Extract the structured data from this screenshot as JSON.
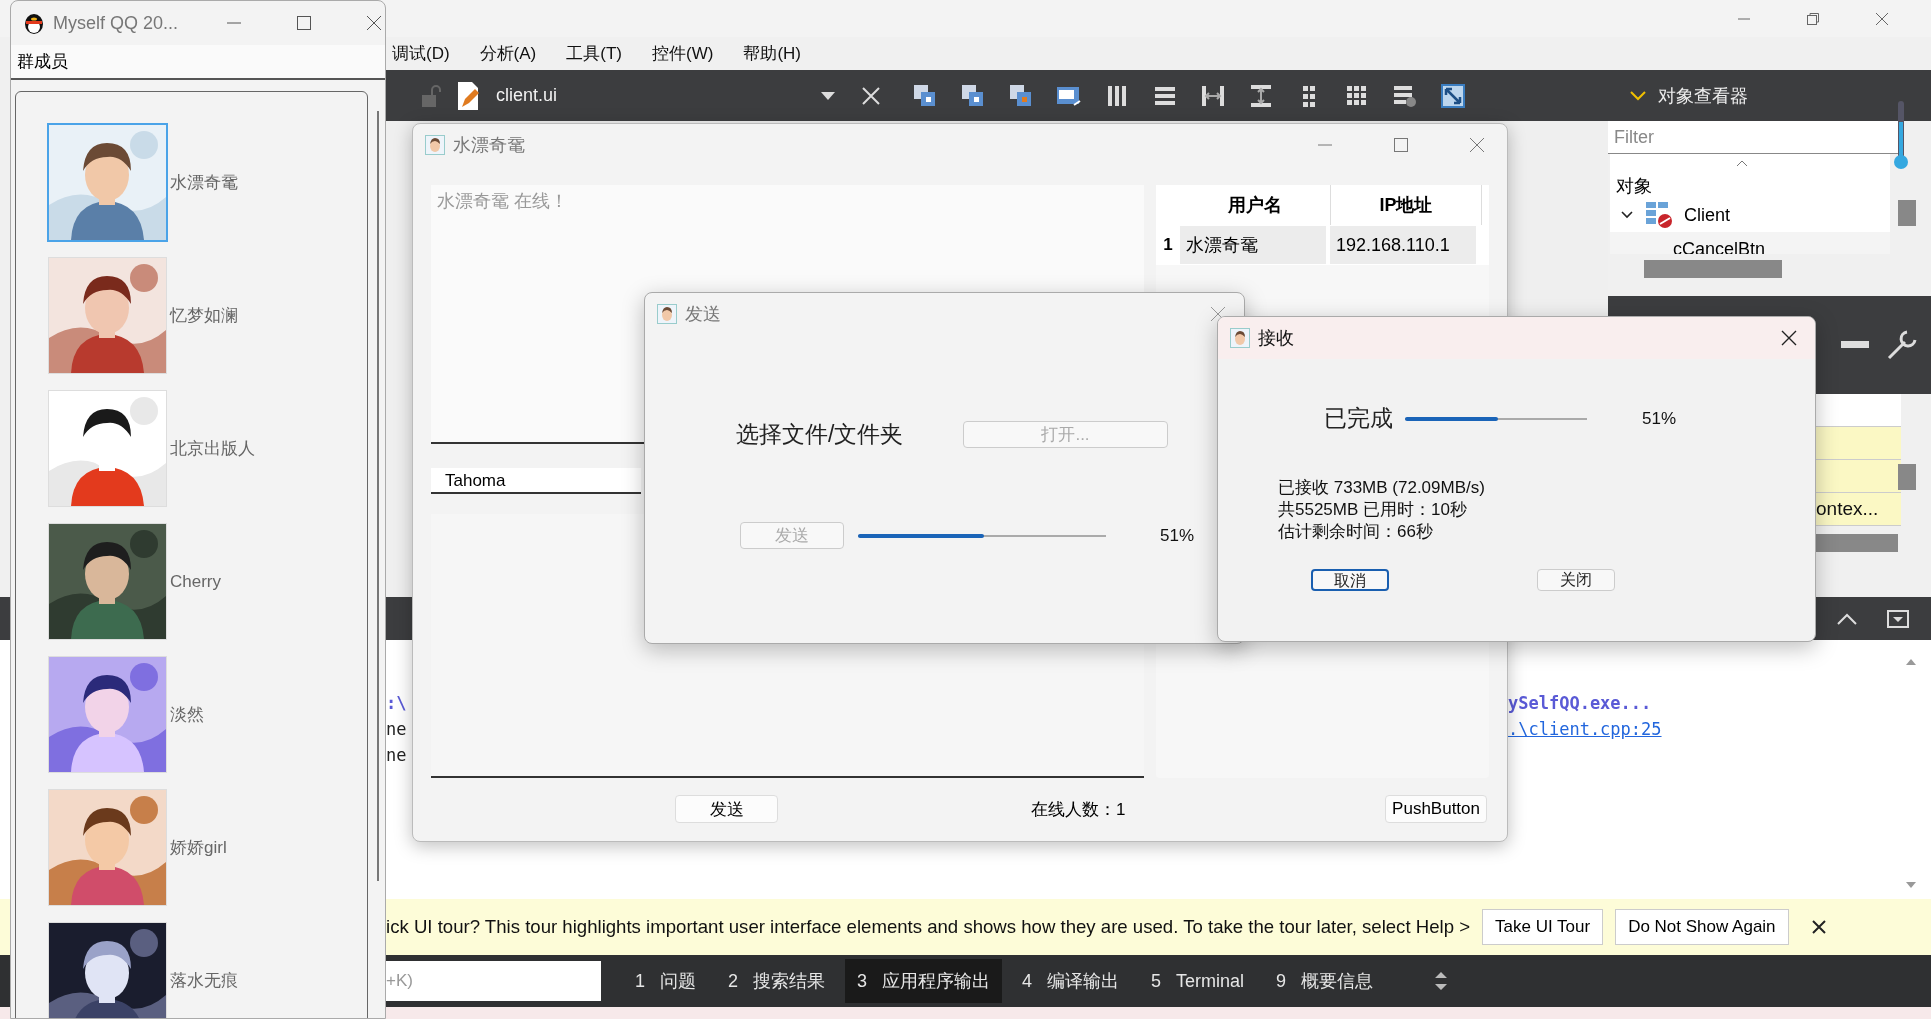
{
  "ide": {
    "menu": [
      "调试(D)",
      "分析(A)",
      "工具(T)",
      "控件(W)",
      "帮助(H)"
    ],
    "toolbar": {
      "file": "client.ui"
    },
    "object_inspector": {
      "title": "对象查看器",
      "filter_placeholder": "Filter",
      "column": "对象",
      "tree": [
        {
          "name": "Client",
          "expanded": true,
          "children": [
            {
              "name": "cCancelBtn"
            }
          ]
        }
      ]
    },
    "property_text": "ontex...",
    "output": {
      "left_lines": [
        {
          "text": ":\\",
          "kind": "path"
        },
        {
          "text": "ne",
          "kind": "plain"
        },
        {
          "text": "ne",
          "kind": "plain"
        }
      ],
      "right_lines": [
        {
          "text": "ySelfQQ.exe...",
          "kind": "path"
        },
        {
          "text": ".\\client.cpp:25",
          "kind": "link"
        }
      ]
    },
    "tour_bar": {
      "message": "ick UI tour? This tour highlights important user interface elements and shows how they are used. To take the tour later, select Help >",
      "buttons": [
        "Take UI Tour",
        "Do Not Show Again"
      ]
    },
    "locator": {
      "value": "+K)"
    },
    "output_tabs": [
      {
        "number": "1",
        "label": "问题",
        "selected": false
      },
      {
        "number": "2",
        "label": "搜索结果",
        "selected": false
      },
      {
        "number": "3",
        "label": "应用程序输出",
        "selected": true
      },
      {
        "number": "4",
        "label": "编译输出",
        "selected": false
      },
      {
        "number": "5",
        "label": "Terminal",
        "selected": false
      },
      {
        "number": "9",
        "label": "概要信息",
        "selected": false
      }
    ]
  },
  "qq_window": {
    "title": "Myself QQ 20...",
    "section": "群成员",
    "members": [
      {
        "name": "水漂奇鼋",
        "selected": true
      },
      {
        "name": "忆梦如澜",
        "selected": false
      },
      {
        "name": "北京出版人",
        "selected": false
      },
      {
        "name": "Cherry",
        "selected": false
      },
      {
        "name": "淡然",
        "selected": false
      },
      {
        "name": "娇娇girl",
        "selected": false
      },
      {
        "name": "落水无痕",
        "selected": false
      }
    ]
  },
  "chat_window": {
    "title": "水漂奇鼋",
    "message": "水漂奇鼋 在线！",
    "font": "Tahoma",
    "user_table": {
      "columns": [
        "用户名",
        "IP地址"
      ],
      "rows": [
        {
          "index": "1",
          "name": "水漂奇鼋",
          "ip": "192.168.110.1"
        }
      ]
    },
    "send_button": "发送",
    "online_count": "在线人数：1",
    "push_button": "PushButton"
  },
  "send_dialog": {
    "title": "发送",
    "prompt": "选择文件/文件夹",
    "open_button": {
      "label": "打开...",
      "disabled": true
    },
    "send_button": {
      "label": "发送",
      "disabled": true
    },
    "progress": {
      "level": 0.51,
      "reading": "51%"
    }
  },
  "receive_dialog": {
    "title": "接收",
    "status": "已完成",
    "progress": {
      "level": 0.51,
      "reading": "51%"
    },
    "details": [
      "已接收 733MB (72.09MB/s)",
      "共5525MB 已用时：10秒",
      "估计剩余时间：66秒"
    ],
    "buttons": [
      {
        "label": "取消",
        "focused": true
      },
      {
        "label": "关闭",
        "focused": false
      }
    ]
  }
}
